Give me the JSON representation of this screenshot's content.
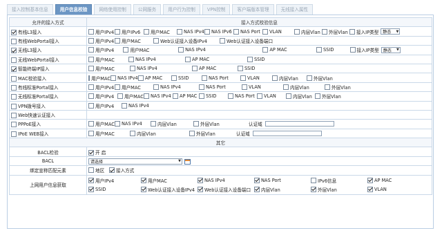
{
  "tabs": [
    "接入控制基本信息",
    "用户信息校验",
    "网络使用控制",
    "公网服务",
    "用户行为控制",
    "VPN控制",
    "客户端版本管理",
    "无线接入属性"
  ],
  "active_tab": 1,
  "headers": {
    "left": "允许的接入方式",
    "right": "接入方式校验信息"
  },
  "rows": [
    {
      "label": "有线L3接入",
      "checked": true,
      "items": [
        {
          "t": "用户IPv4",
          "c": false
        },
        {
          "t": "用户IPv6",
          "c": false
        },
        {
          "t": "用户MAC",
          "c": false
        },
        {
          "t": "NAS IPv4",
          "c": false
        },
        {
          "t": "NAS IPv6",
          "c": false
        },
        {
          "t": "NAS Port",
          "c": false
        },
        {
          "t": "VLAN",
          "c": false
        },
        {
          "t": "内层Vlan",
          "c": false
        },
        {
          "t": "外层Vlan",
          "c": false
        },
        {
          "t": "接入IP类型",
          "c": false,
          "select": "静态"
        }
      ]
    },
    {
      "label": "有线WebPortal接入",
      "checked": false,
      "items": [
        {
          "t": "用户IPv4",
          "c": false
        },
        {
          "t": "用户MAC",
          "c": false
        },
        {
          "t": "Web认证接入设备IPv4",
          "c": false
        },
        {
          "t": "Web认证接入设备端口",
          "c": false
        }
      ]
    },
    {
      "label": "无线L3接入",
      "checked": true,
      "items": [
        {
          "t": "用户IPv4",
          "c": false
        },
        {
          "t": "用户MAC",
          "c": false
        },
        {
          "t": "NAS IPv4",
          "c": false
        },
        {
          "t": "AP MAC",
          "c": false
        },
        {
          "t": "SSID",
          "c": false
        },
        {
          "t": "接入IP类型",
          "c": false,
          "select": "静态"
        }
      ]
    },
    {
      "label": "无线WebPortal接入",
      "checked": false,
      "items": [
        {
          "t": "用户MAC",
          "c": false
        },
        {
          "t": "NAS IPv4",
          "c": false
        },
        {
          "t": "AP MAC",
          "c": false
        },
        {
          "t": "SSID",
          "c": false
        }
      ]
    },
    {
      "label": "智能终端IP接入",
      "checked": true,
      "items": [
        {
          "t": "用户MAC",
          "c": false
        },
        {
          "t": "NAS IPv4",
          "c": false
        },
        {
          "t": "AP MAC",
          "c": false
        },
        {
          "t": "SSID",
          "c": false
        }
      ]
    },
    {
      "label": "MAC校验接入",
      "checked": false,
      "items": [
        {
          "t": "用户MAC",
          "c": false
        },
        {
          "t": "NAS IPv4",
          "c": false
        },
        {
          "t": "AP MAC",
          "c": false
        },
        {
          "t": "SSID",
          "c": false
        },
        {
          "t": "NAS Port",
          "c": false
        },
        {
          "t": "VLAN",
          "c": false
        },
        {
          "t": "内层Vlan",
          "c": false
        },
        {
          "t": "外层Vlan",
          "c": false
        }
      ]
    },
    {
      "label": "有线标准Portal接入",
      "checked": false,
      "items": [
        {
          "t": "用户IPv4",
          "c": false
        },
        {
          "t": "用户MAC",
          "c": false
        },
        {
          "t": "NAS IPv4",
          "c": false
        },
        {
          "t": "NAS Port",
          "c": false
        },
        {
          "t": "VLAN",
          "c": false
        },
        {
          "t": "内层Vlan",
          "c": false
        },
        {
          "t": "外层Vlan",
          "c": false
        }
      ]
    },
    {
      "label": "无线标准Portal接入",
      "checked": false,
      "items": [
        {
          "t": "用户IPv4",
          "c": false
        },
        {
          "t": "用户MAC",
          "c": false
        },
        {
          "t": "NAS IPv4",
          "c": false
        },
        {
          "t": "AP MAC",
          "c": false
        },
        {
          "t": "SSID",
          "c": false
        },
        {
          "t": "NAS Port",
          "c": false
        },
        {
          "t": "VLAN",
          "c": false
        },
        {
          "t": "内层Vlan",
          "c": false
        },
        {
          "t": "外层Vlan",
          "c": false
        }
      ]
    },
    {
      "label": "VPN拨号接入",
      "checked": false,
      "items": [
        {
          "t": "用户IPv4",
          "c": false
        },
        {
          "t": "NAS IPv4",
          "c": false
        }
      ]
    },
    {
      "label": "Web快速认证接入",
      "checked": false,
      "items": []
    },
    {
      "label": "PPPoE接入",
      "checked": false,
      "items": [
        {
          "t": "用户MAC",
          "c": false
        },
        {
          "t": "NAS IPv4",
          "c": false
        },
        {
          "t": "内层Vlan",
          "c": false
        },
        {
          "t": "外层Vlan",
          "c": false
        },
        {
          "t": "认证域",
          "input": true
        }
      ]
    },
    {
      "label": "IPoE WEB接入",
      "checked": false,
      "items": [
        {
          "t": "用户MAC",
          "c": false
        },
        {
          "t": "内层Vlan",
          "c": false
        },
        {
          "t": "外层Vlan",
          "c": false
        },
        {
          "t": "认证域",
          "input": true
        }
      ]
    }
  ],
  "other": {
    "header": "其它",
    "bacl_check_label": "BACL检验",
    "bacl_check_option": "开 启",
    "bacl_label": "BACL",
    "bacl_select": "请选择",
    "bind_label": "绑定宣称匹配元素",
    "bind_options": [
      {
        "t": "地区",
        "c": false
      },
      {
        "t": "接入方式",
        "c": true
      }
    ],
    "fetch_label": "上网用户信息获取",
    "fetch_row1": [
      {
        "t": "用户IPv4",
        "c": true
      },
      {
        "t": "用户MAC",
        "c": true
      },
      {
        "t": "NAS IPv4",
        "c": true
      },
      {
        "t": "NAS Port",
        "c": true
      },
      {
        "t": "IPv6信息",
        "c": false
      },
      {
        "t": "AP MAC",
        "c": true
      }
    ],
    "fetch_row2": [
      {
        "t": "SSID",
        "c": true
      },
      {
        "t": "Web认证接入设备IPv4",
        "c": true
      },
      {
        "t": "Web认证接入设备端口",
        "c": true
      },
      {
        "t": "内层Vlan",
        "c": true
      },
      {
        "t": "外层Vlan",
        "c": true
      },
      {
        "t": "VLAN",
        "c": true
      }
    ]
  }
}
